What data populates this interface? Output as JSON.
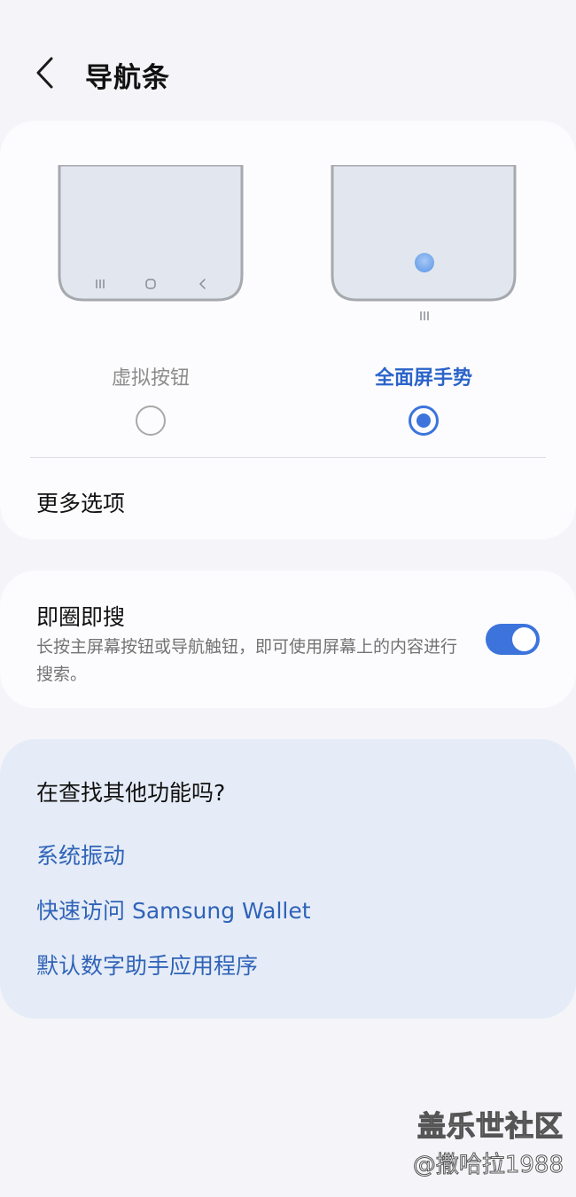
{
  "header": {
    "title": "导航条",
    "back_icon": "chevron-left-icon"
  },
  "navigation_type": {
    "options": [
      {
        "label": "虚拟按钮",
        "selected": false,
        "preview_icons": [
          "recents-icon",
          "home-icon",
          "back-icon"
        ]
      },
      {
        "label": "全面屏手势",
        "selected": true,
        "preview_icons": [
          "gesture-hint-icon",
          "gesture-handle-icon"
        ]
      }
    ],
    "more_options_label": "更多选项"
  },
  "circle_to_search": {
    "title": "即圈即搜",
    "description": "长按主屏幕按钮或导航触钮，即可使用屏幕上的内容进行搜索。",
    "enabled": true
  },
  "suggestions": {
    "title": "在查找其他功能吗?",
    "links": [
      "系统振动",
      "快速访问 Samsung Wallet",
      "默认数字助手应用程序"
    ]
  },
  "watermark": {
    "line1": "盖乐世社区",
    "line2": "@撒哈拉1988"
  },
  "colors": {
    "accent": "#3c74dc",
    "link": "#2f63b8",
    "background": "#f5f5f9",
    "suggestion_card": "#e6ecf7"
  }
}
